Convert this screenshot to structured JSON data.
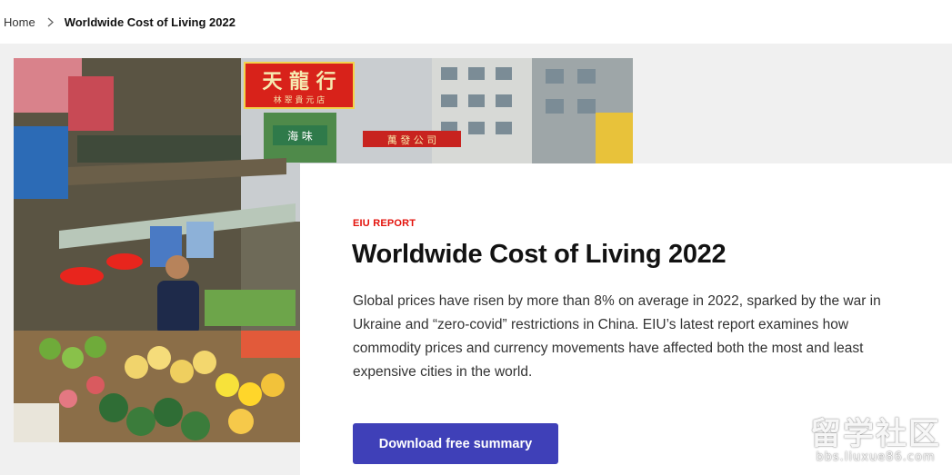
{
  "breadcrumb": {
    "home": "Home",
    "current": "Worldwide Cost of Living 2022"
  },
  "hero": {
    "image_alt": "Street market with fruit and vegetable stalls and shop signs",
    "signs": {
      "top_sign": "天 龍 行",
      "top_sign_small": "林 翠 貴 元 店",
      "side_sign": "萬 發 公 司",
      "green_sign": "海 味"
    }
  },
  "card": {
    "eyebrow": "EIU REPORT",
    "title": "Worldwide Cost of Living 2022",
    "description": "Global prices have risen by more than 8% on average in 2022, sparked by the war in Ukraine and “zero-covid” restrictions in China. EIU’s latest report examines how commodity prices and currency movements have affected both the most and least expensive cities in the world.",
    "cta_label": "Download free summary"
  },
  "watermark": {
    "main": "留学社区",
    "sub": "bbs.liuxue86.com"
  },
  "colors": {
    "accent_red": "#e3120b",
    "button_blue": "#3f40b8",
    "text_dark": "#121212",
    "page_bg": "#f0f0f0"
  }
}
